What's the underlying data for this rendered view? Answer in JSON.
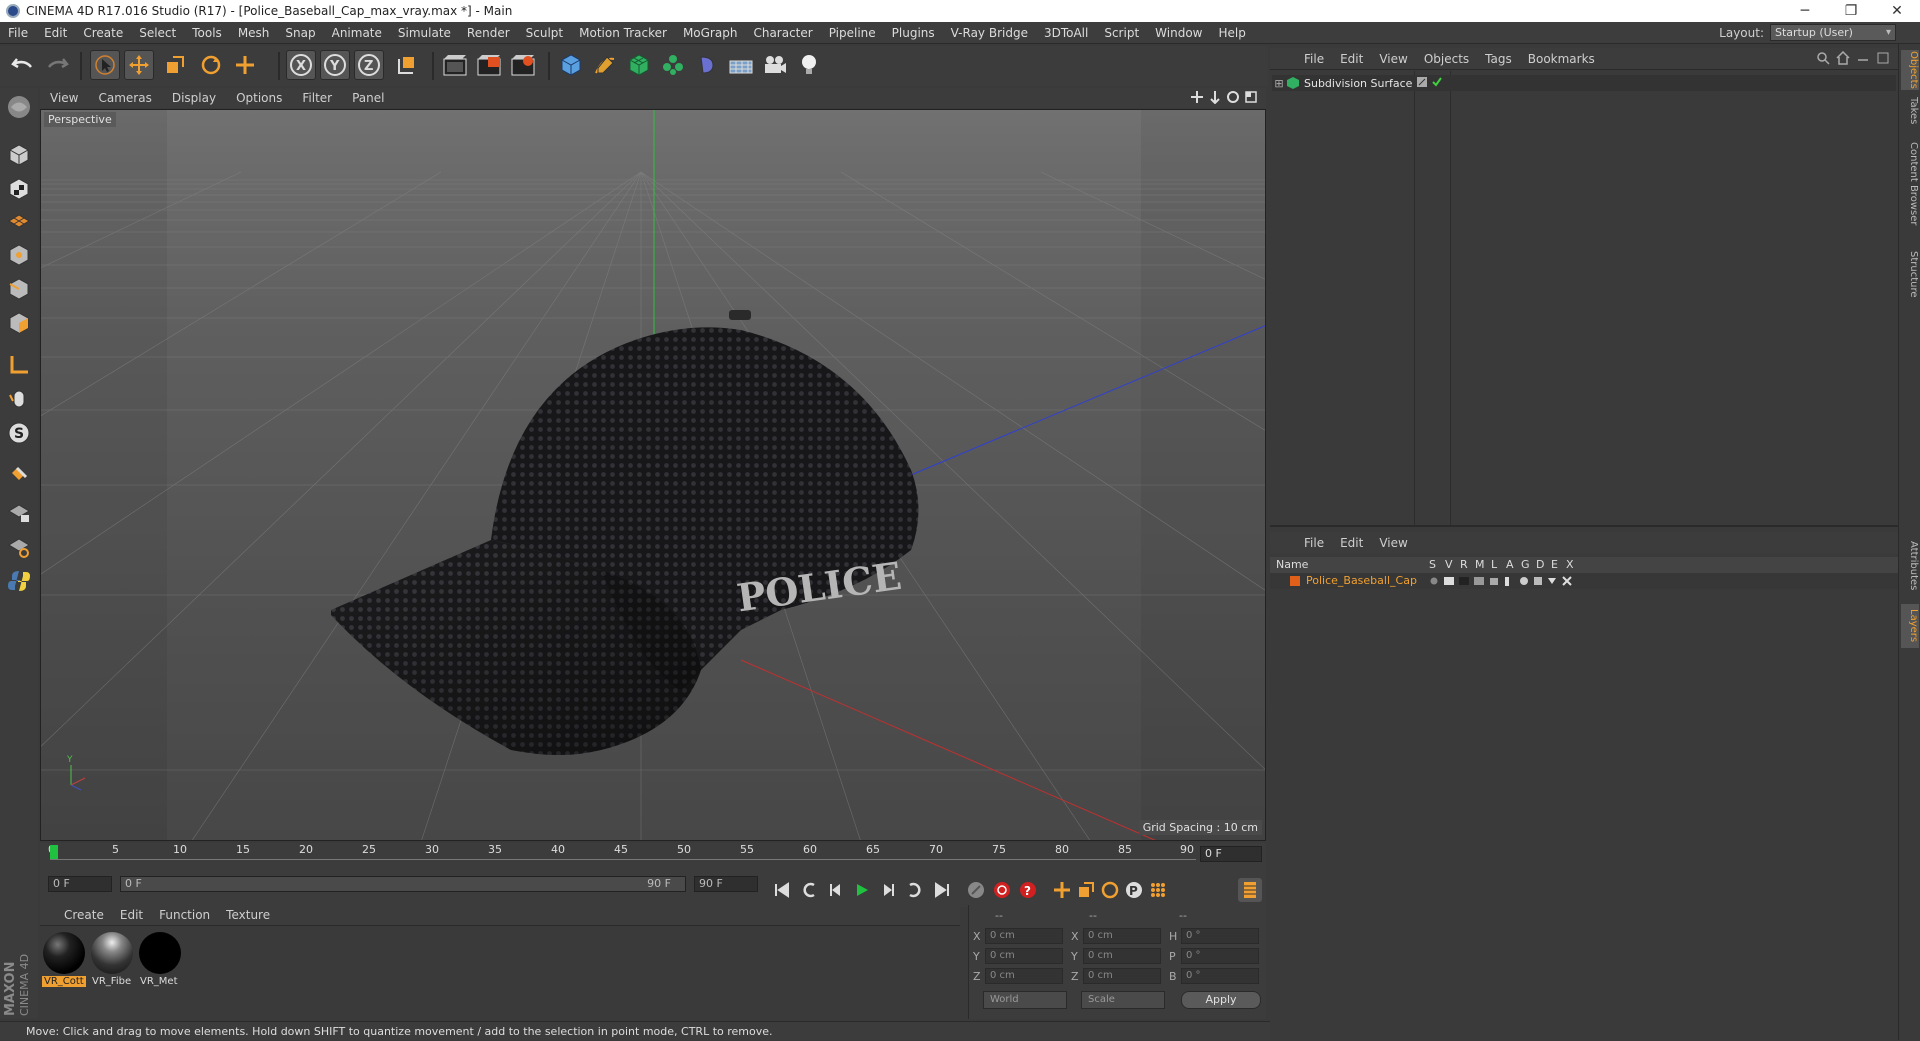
{
  "title": "CINEMA 4D R17.016 Studio (R17) - [Police_Baseball_Cap_max_vray.max *] - Main",
  "window_controls": [
    "─",
    "❐",
    "✕"
  ],
  "menu": [
    "File",
    "Edit",
    "Create",
    "Select",
    "Tools",
    "Mesh",
    "Snap",
    "Animate",
    "Simulate",
    "Render",
    "Sculpt",
    "Motion Tracker",
    "MoGraph",
    "Character",
    "Pipeline",
    "Plugins",
    "V-Ray Bridge",
    "3DToAll",
    "Script",
    "Window",
    "Help"
  ],
  "layout": {
    "label": "Layout:",
    "value": "Startup (User)"
  },
  "viewport": {
    "menu": [
      "View",
      "Cameras",
      "Display",
      "Options",
      "Filter",
      "Panel"
    ],
    "camera_label": "Perspective",
    "grid_spacing": "Grid Spacing : 10 cm",
    "model_text": "POLICE"
  },
  "timeline": {
    "ticks": [
      "0",
      "5",
      "10",
      "15",
      "20",
      "25",
      "30",
      "35",
      "40",
      "45",
      "50",
      "55",
      "60",
      "65",
      "70",
      "75",
      "80",
      "85",
      "90"
    ],
    "current_frame": "0 F"
  },
  "transport": {
    "start_field": "0 F",
    "range_start": "0 F",
    "range_end": "90 F",
    "end_field": "90 F"
  },
  "materials": {
    "menu": [
      "Create",
      "Edit",
      "Function",
      "Texture"
    ],
    "items": [
      {
        "label": "VR_Cott",
        "selected": true
      },
      {
        "label": "VR_Fibe",
        "selected": false
      },
      {
        "label": "VR_Met",
        "selected": false
      }
    ]
  },
  "coordinates": {
    "headers": [
      "--",
      "--",
      "--"
    ],
    "rows": [
      {
        "l1": "X",
        "v1": "0 cm",
        "l2": "X",
        "v2": "0 cm",
        "l3": "H",
        "v3": "0 °"
      },
      {
        "l1": "Y",
        "v1": "0 cm",
        "l2": "Y",
        "v2": "0 cm",
        "l3": "P",
        "v3": "0 °"
      },
      {
        "l1": "Z",
        "v1": "0 cm",
        "l2": "Z",
        "v2": "0 cm",
        "l3": "B",
        "v3": "0 °"
      }
    ],
    "mode_select": "World",
    "scale_select": "Scale",
    "apply": "Apply"
  },
  "status": "Move: Click and drag to move elements. Hold down SHIFT to quantize movement / add to the selection in point mode, CTRL to remove.",
  "brand": {
    "line1": "MAXON",
    "line2": "CINEMA 4D"
  },
  "objects_panel": {
    "menu": [
      "File",
      "Edit",
      "View",
      "Objects",
      "Tags",
      "Bookmarks"
    ],
    "items": [
      {
        "label": "Subdivision Surface"
      }
    ]
  },
  "layers_panel": {
    "menu": [
      "File",
      "Edit",
      "View"
    ],
    "columns": [
      "Name",
      "S",
      "V",
      "R",
      "M",
      "L",
      "A",
      "G",
      "D",
      "E",
      "X"
    ],
    "items": [
      {
        "label": "Police_Baseball_Cap",
        "color": "#e0601a"
      }
    ]
  },
  "side_tabs": [
    "Objects",
    "Takes",
    "Content Browser",
    "Structure",
    "Attributes",
    "Layers"
  ],
  "colors": {
    "accent": "#f0a030",
    "layer_label": "#f0a030",
    "timeline_marker": "#20c040"
  }
}
